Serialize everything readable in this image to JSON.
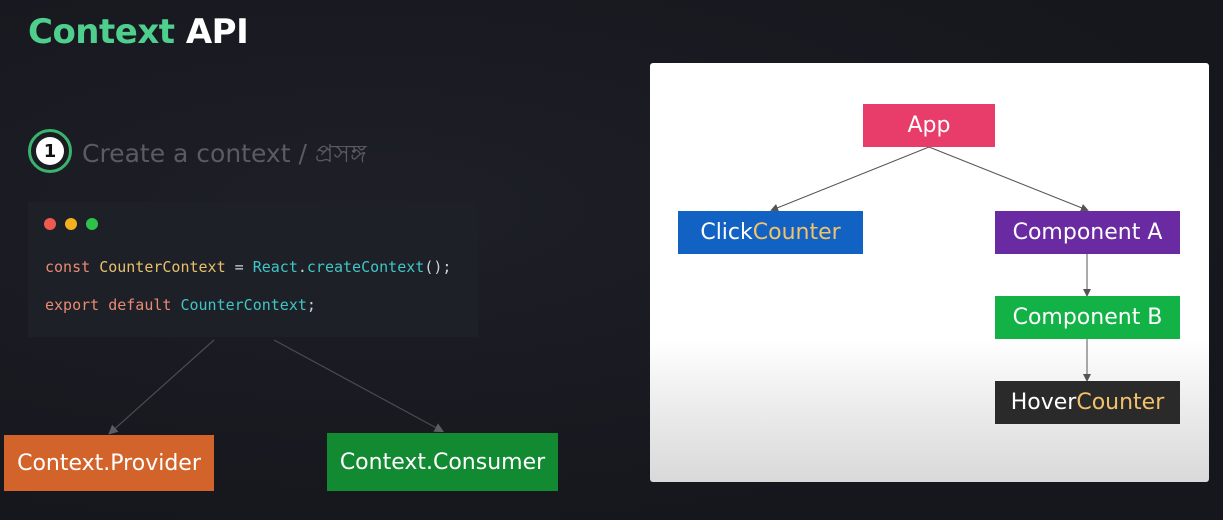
{
  "title": {
    "part1": "Context",
    "part2": "API"
  },
  "step": {
    "number": "1",
    "text": "Create a context / প্রসঙ্গ"
  },
  "code": {
    "line1": {
      "keyword": "const",
      "name": "CounterContext",
      "equals": "=",
      "object": "React",
      "dot": ".",
      "method": "createContext",
      "tail": "();"
    },
    "line2": {
      "keywords": "export default",
      "name": "CounterContext",
      "tail": ";"
    }
  },
  "left_nodes": {
    "provider": "Context.Provider",
    "consumer": "Context.Consumer"
  },
  "tree": {
    "app": "App",
    "click_counter": {
      "prefix": "Click",
      "suffix": "Counter"
    },
    "component_a": "Component A",
    "component_b": "Component B",
    "hover_counter": {
      "prefix": "Hover",
      "suffix": "Counter"
    }
  },
  "colors": {
    "title_accent": "#4fcf8d",
    "step_badge": "#39b36e",
    "provider": "#d2642b",
    "consumer": "#128a32",
    "app": "#e83c6b",
    "click_counter": "#1162c2",
    "component_a": "#6a2ba2",
    "component_b": "#12b247",
    "hover_counter": "#2a2a2a",
    "counter_accent": "#f1c26b"
  }
}
